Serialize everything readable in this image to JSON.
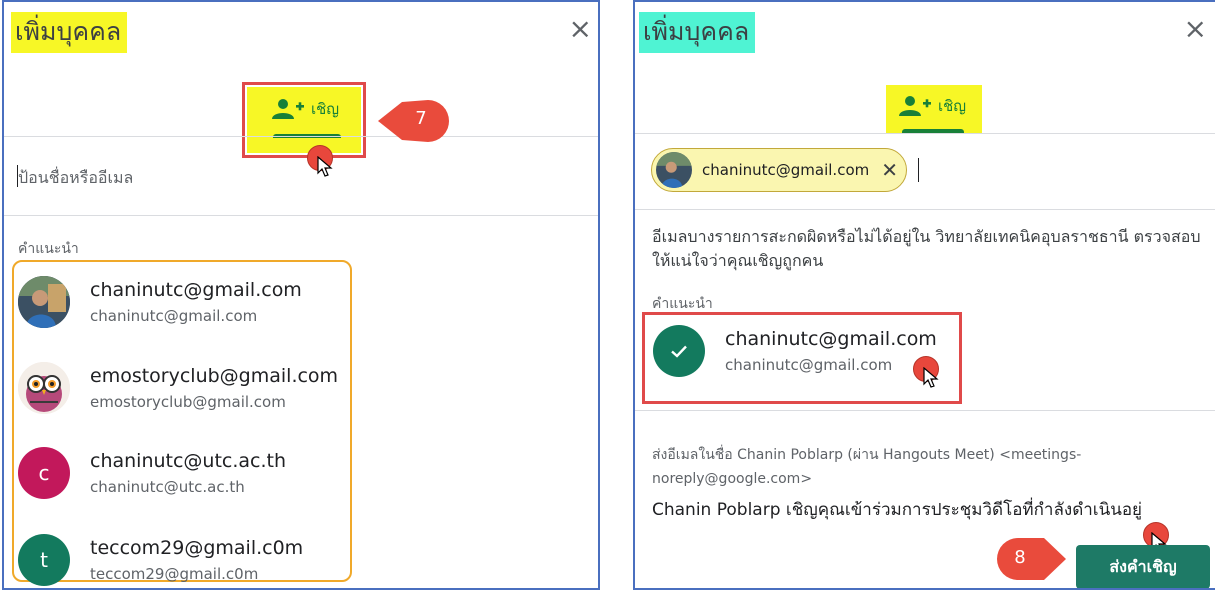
{
  "left_panel": {
    "title": "เพิ่มบุคคล",
    "close_glyph": "×",
    "tab_label": "เชิญ",
    "input_placeholder": "ป้อนชื่อหรืออีเมล",
    "suggestions_label": "คำแนะนำ",
    "suggestions": [
      {
        "name": "chaninutc@gmail.com",
        "email": "chaninutc@gmail.com",
        "avatar": "photo"
      },
      {
        "name": "emostoryclub@gmail.com",
        "email": "emostoryclub@gmail.com",
        "avatar": "owl"
      },
      {
        "name": "chaninutc@utc.ac.th",
        "email": "chaninutc@utc.ac.th",
        "avatar": "letter",
        "letter": "c",
        "color": "#c2185b"
      },
      {
        "name": "teccom29@gmail.c0m",
        "email": "teccom29@gmail.c0m",
        "avatar": "letter",
        "letter": "t",
        "color": "#137a5e"
      }
    ],
    "step_number": "7"
  },
  "right_panel": {
    "title": "เพิ่มบุคคล",
    "close_glyph": "×",
    "tab_label": "เชิญ",
    "chip_label": "chaninutc@gmail.com",
    "warning": "อีเมลบางรายการสะกดผิดหรือไม่ได้อยู่ใน วิทยาลัยเทคนิคอุบลราชธานี ตรวจสอบให้แน่ใจว่าคุณเชิญถูกคน",
    "suggestions_label": "คำแนะนำ",
    "selected": {
      "name": "chaninutc@gmail.com",
      "email": "chaninutc@gmail.com"
    },
    "sender_line": "ส่งอีเมลในชื่อ Chanin Poblarp (ผ่าน Hangouts Meet) <meetings-noreply@google.com>",
    "invite_message": "Chanin Poblarp เชิญคุณเข้าร่วมการประชุมวิดีโอที่กำลังดำเนินอยู่",
    "send_label": "ส่งคำเชิญ",
    "step_number": "8"
  },
  "colors": {
    "accent_green": "#188038",
    "send_button": "#1e7a66",
    "highlight_yellow": "#f7f726",
    "highlight_teal": "#4ff3d3",
    "annotation_red": "#e94b3c"
  },
  "icons": [
    "close-icon",
    "person-add-icon",
    "check-icon",
    "mouse-pointer-icon"
  ]
}
